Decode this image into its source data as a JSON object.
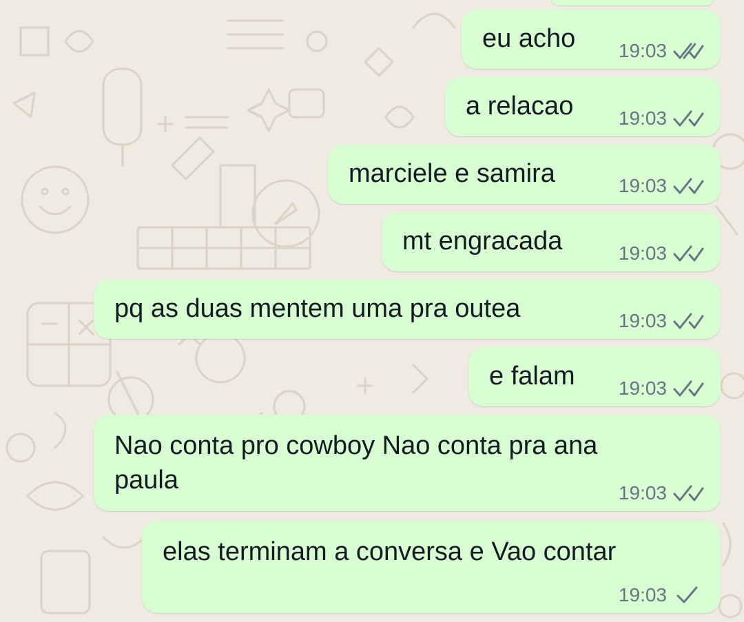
{
  "chat": {
    "messages": [
      {
        "text": "eu acho",
        "time": "19:03",
        "status": "read",
        "status_icon": "double-check-icon"
      },
      {
        "text": "a relacao",
        "time": "19:03",
        "status": "read",
        "status_icon": "double-check-icon"
      },
      {
        "text": "marciele e samira",
        "time": "19:03",
        "status": "read",
        "status_icon": "double-check-icon"
      },
      {
        "text": "mt engracada",
        "time": "19:03",
        "status": "read",
        "status_icon": "double-check-icon"
      },
      {
        "text": "pq as duas mentem uma pra outea",
        "time": "19:03",
        "status": "read",
        "status_icon": "double-check-icon"
      },
      {
        "text": "e falam",
        "time": "19:03",
        "status": "read",
        "status_icon": "double-check-icon"
      },
      {
        "lines": [
          "Nao conta pro cowboy Nao conta pra ana",
          "paula"
        ],
        "time": "19:03",
        "status": "read",
        "status_icon": "double-check-icon"
      },
      {
        "text": "elas terminam a conversa e Vao contar",
        "time": "19:03",
        "status": "sent",
        "status_icon": "single-check-icon"
      }
    ]
  },
  "colors": {
    "background": "#efeae2",
    "outgoing_bubble": "#d9fdd3",
    "message_text": "#111b21",
    "meta_text": "#667781",
    "tick": "#667781",
    "wallpaper_doodle": "#d8cfc1"
  }
}
